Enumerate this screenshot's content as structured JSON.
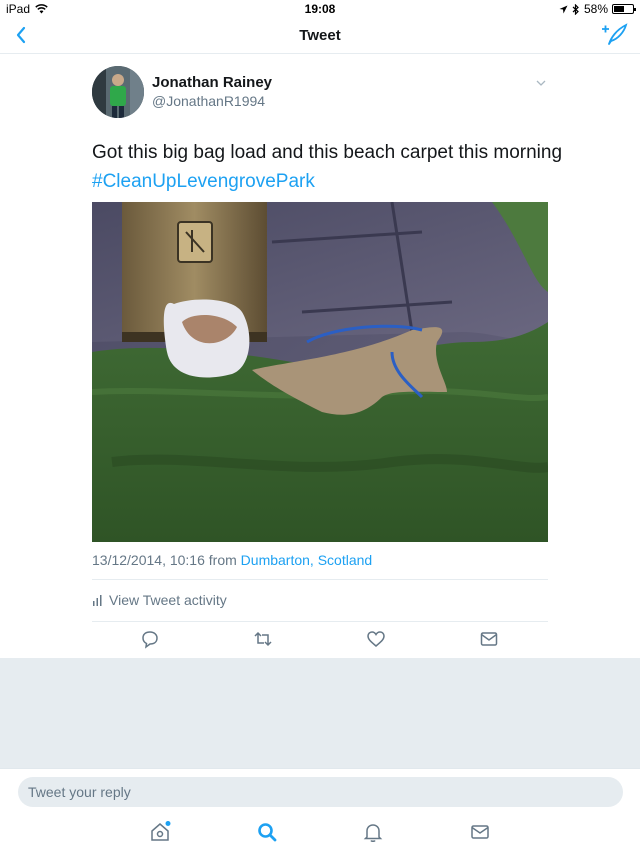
{
  "status_bar": {
    "device": "iPad",
    "time": "19:08",
    "battery_percent": "58%",
    "battery_level": 0.58
  },
  "nav": {
    "title": "Tweet",
    "back_icon": "chevron-left-icon",
    "compose_icon": "compose-tweet-icon"
  },
  "tweet": {
    "author_name": "Jonathan Rainey",
    "author_handle": "@JonathanR1994",
    "text": "Got this big bag load and this beach carpet this morning",
    "hashtag": "#CleanUpLevengrovePark",
    "timestamp": "13/12/2014, 10:16 from",
    "location": "Dumbarton, Scotland",
    "activity_label": "View Tweet activity"
  },
  "actions": [
    "reply-icon",
    "retweet-icon",
    "like-icon",
    "direct-message-icon"
  ],
  "reply": {
    "placeholder": "Tweet your reply"
  },
  "tabbar": [
    "home-icon",
    "search-icon",
    "notifications-icon",
    "messages-icon"
  ],
  "colors": {
    "accent": "#1da1f2",
    "secondary_text": "#657786",
    "background_gray": "#e6ecf0"
  }
}
